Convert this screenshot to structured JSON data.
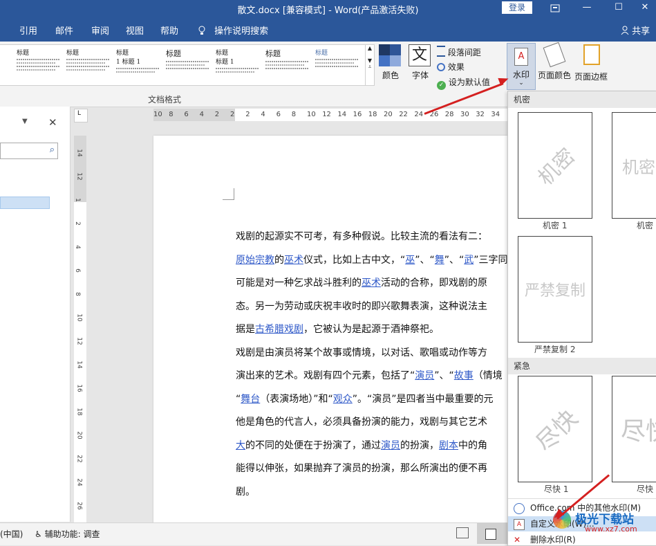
{
  "window": {
    "title": "散文.docx [兼容模式] - Word(产品激活失败)",
    "login": "登录",
    "ribbon_toggle_icon": "ribbon-display-icon",
    "min": "—",
    "max": "☐",
    "close": "✕"
  },
  "tabs": [
    "引用",
    "邮件",
    "审阅",
    "视图",
    "帮助"
  ],
  "tell_me": "操作说明搜索",
  "share": "共享",
  "gallery": {
    "items": [
      {
        "a": "标题",
        "b": ""
      },
      {
        "a": "标题",
        "b": ""
      },
      {
        "a": "标题",
        "b": "1 标题 1"
      },
      {
        "a": "标题",
        "b": ""
      },
      {
        "a": "标题",
        "b": "标题 1"
      },
      {
        "a": "标题",
        "b": ""
      },
      {
        "a": "标题",
        "b": ""
      }
    ]
  },
  "ribbon": {
    "colors": "颜色",
    "fonts": "字体",
    "fonts_glyph": "文",
    "para_spacing": "段落间距",
    "effects": "效果",
    "set_default": "设为默认值",
    "watermark": "水印",
    "page_color": "页面颜色",
    "page_border": "页面边框",
    "group_label": "文档格式"
  },
  "hruler": [
    "10",
    "8",
    "6",
    "4",
    "2",
    "2",
    "2",
    "4",
    "6",
    "8",
    "10",
    "12",
    "14",
    "16",
    "18",
    "20",
    "22",
    "24",
    "26",
    "28",
    "30",
    "32",
    "34"
  ],
  "vruler": [
    "14",
    "12",
    "1",
    "2",
    "4",
    "6",
    "8",
    "10",
    "12",
    "14",
    "16",
    "18",
    "20",
    "22",
    "24",
    "26"
  ],
  "document": {
    "lines": [
      [
        {
          "t": "戏剧的起源实不可考，有多种假说。比较主流的看法有二："
        }
      ],
      [
        {
          "t": "原始宗教",
          "l": true
        },
        {
          "t": "的"
        },
        {
          "t": "巫术",
          "l": true
        },
        {
          "t": "仪式，比如上古中文，“"
        },
        {
          "t": "巫",
          "l": true
        },
        {
          "t": "”、“"
        },
        {
          "t": "舞",
          "l": true
        },
        {
          "t": "”、“"
        },
        {
          "t": "武",
          "l": true
        },
        {
          "t": "”三字同"
        }
      ],
      [
        {
          "t": "可能是对一种乞求战斗胜利的"
        },
        {
          "t": "巫术",
          "l": true
        },
        {
          "t": "活动的合称，即戏剧的原"
        }
      ],
      [
        {
          "t": "态。另一为劳动或庆祝丰收时的即兴歌舞表演，这种说法主"
        }
      ],
      [
        {
          "t": "据是"
        },
        {
          "t": "古希腊戏剧",
          "l": true
        },
        {
          "t": "，它被认为是起源于酒神祭祀。"
        }
      ],
      [
        {
          "t": "戏剧是由演员将某个故事或情境，以对话、歌唱或动作等方"
        }
      ],
      [
        {
          "t": "演出来的艺术。戏剧有四个元素，包括了“"
        },
        {
          "t": "演员",
          "l": true
        },
        {
          "t": "”、“"
        },
        {
          "t": "故事",
          "l": true
        },
        {
          "t": "（情境"
        }
      ],
      [
        {
          "t": "“"
        },
        {
          "t": "舞台",
          "l": true
        },
        {
          "t": "（表演场地）”和“"
        },
        {
          "t": "观众",
          "l": true
        },
        {
          "t": "”。“演员”是四者当中最重要的元"
        }
      ],
      [
        {
          "t": "他是角色的代言人，必须具备扮演的能力，戏剧与其它艺术"
        }
      ],
      [
        {
          "t": "大",
          "l": true
        },
        {
          "t": "的不同的处便在于扮演了，通过"
        },
        {
          "t": "演员",
          "l": true
        },
        {
          "t": "的扮演，"
        },
        {
          "t": "剧本",
          "l": true
        },
        {
          "t": "中的角"
        }
      ],
      [
        {
          "t": "能得以伸张，如果抛弃了演员的扮演，那么所演出的便不再"
        }
      ],
      [
        {
          "t": "剧。"
        }
      ]
    ]
  },
  "status": {
    "lang": "(中国)",
    "accessibility": "辅助功能: 调查"
  },
  "dropdown": {
    "section1": "机密",
    "section2": "紧急",
    "cards": [
      {
        "text": "机密",
        "caption": "机密 1",
        "rot": -45
      },
      {
        "text": "机密",
        "caption": "机密",
        "rot": 0
      },
      {
        "text": "严禁复制",
        "caption": "严禁复制 2",
        "rot": 0
      },
      {
        "text": "尽快",
        "caption": "尽快 1",
        "rot": -45
      },
      {
        "text": "尽快",
        "caption": "尽快",
        "rot": 0
      }
    ],
    "menu": [
      "Office.com 中的其他水印(M)",
      "自定义水印(W)...",
      "删除水印(R)"
    ]
  },
  "site_watermark": {
    "name": "极光下载站",
    "url": "www.xz7.com"
  },
  "colors": {
    "accent": "#2b579a",
    "arrow": "#d42020",
    "link": "#2e58c8"
  }
}
